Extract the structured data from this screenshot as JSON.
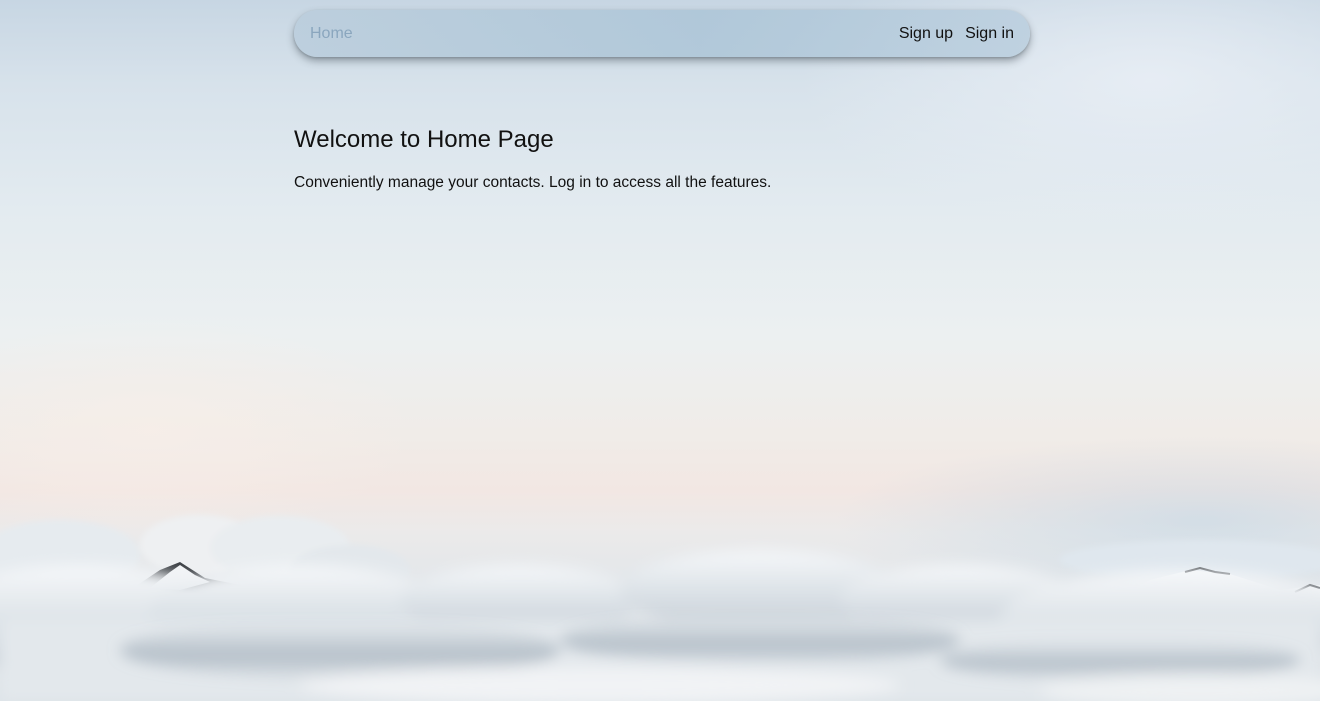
{
  "nav": {
    "home_label": "Home",
    "signup_label": "Sign up",
    "signin_label": "Sign in"
  },
  "main": {
    "title": "Welcome to Home Page",
    "subtitle": "Conveniently manage your contacts. Log in to access all the features."
  },
  "colors": {
    "home_link": "#8aa6be",
    "text": "#111111",
    "navbar_bg": "#b3c9da"
  },
  "background": {
    "description_icon": "sky-clouds-mountains-background"
  }
}
